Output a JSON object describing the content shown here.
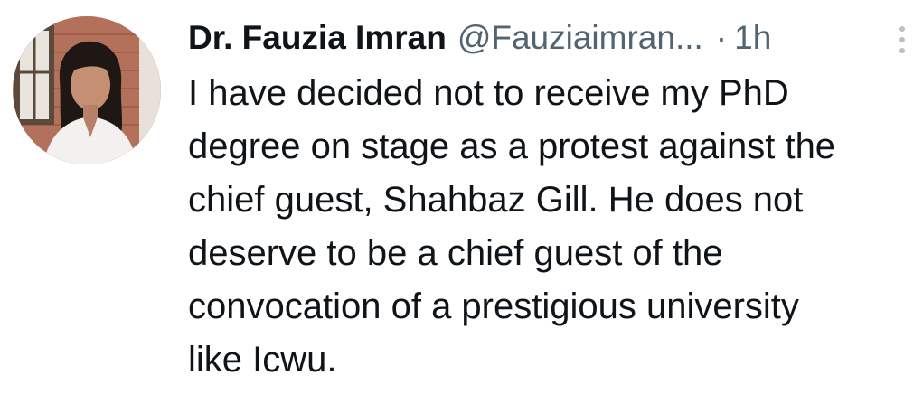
{
  "tweet": {
    "author": {
      "display_name": "Dr. Fauzia Imran",
      "handle": "@Fauziaimran...",
      "avatar_icon": "profile-photo"
    },
    "separator": "·",
    "timestamp": "1h",
    "more_icon": "more-vertical-icon",
    "text_lines": [
      "I have decided not to receive my PhD",
      "degree on stage as a protest against the",
      "chief guest, Shahbaz Gill. He does not",
      "deserve to be a chief guest of the",
      "convocation of a prestigious university",
      "like Icwu."
    ]
  }
}
